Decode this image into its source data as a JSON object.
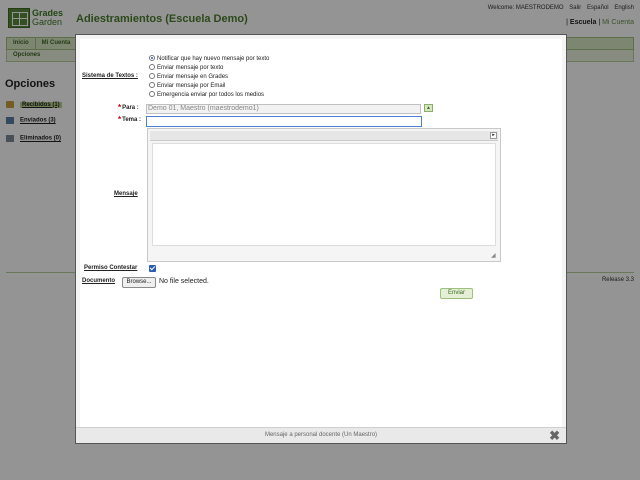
{
  "header": {
    "logo_line1": "Grades",
    "logo_line2": "Garden",
    "app_title": "Adiestramientos (Escuela Demo)",
    "welcome": "Welcome: MAESTRODEMO",
    "logout": "Salir",
    "lang_es": "Español",
    "lang_en": "English",
    "school_active": "Escuela",
    "school_other": "Mi Cuenta"
  },
  "nav": {
    "tabs": [
      "Inicio",
      "Mi Cuenta"
    ],
    "subtabs": [
      "Opciones"
    ]
  },
  "sidebar": {
    "title": "Opciones",
    "folders": [
      "Recibidos (1)",
      "Enviados (3)",
      "Eliminados (0)"
    ]
  },
  "footer": {
    "release": "Release 3.3"
  },
  "modal": {
    "caption": "Mensaje a personal docente (Un Maestro)",
    "close_symbol": "✖",
    "labels": {
      "sistema": "Sistema de Textos :",
      "para": "Para :",
      "tema": "Tema :",
      "mensaje": "Mensaje",
      "permiso": "Permiso Contestar",
      "documento": "Documento"
    },
    "required_mark": "*",
    "notify_options": [
      "Notificar que hay nuevo mensaje por texto",
      "Enviar mensaje por texto",
      "Enviar mensaje en Grades",
      "Enviar mensaje por Email",
      "Emergencia enviar por todos los medios"
    ],
    "notify_selected_index": 0,
    "para_value": "Demo 01, Maestro (maestrodemo1)",
    "tema_value": "",
    "permiso_checked": true,
    "browse_label": "Browse...",
    "no_file": "No file selected.",
    "send_label": "Enviar"
  },
  "colors": {
    "brand_green": "#4c7f2d",
    "nav_bg": "#d8e7c3",
    "overlay": "rgba(0,0,0,0.42)",
    "required": "#cc0000",
    "focus_blue": "#4a7fd0"
  }
}
